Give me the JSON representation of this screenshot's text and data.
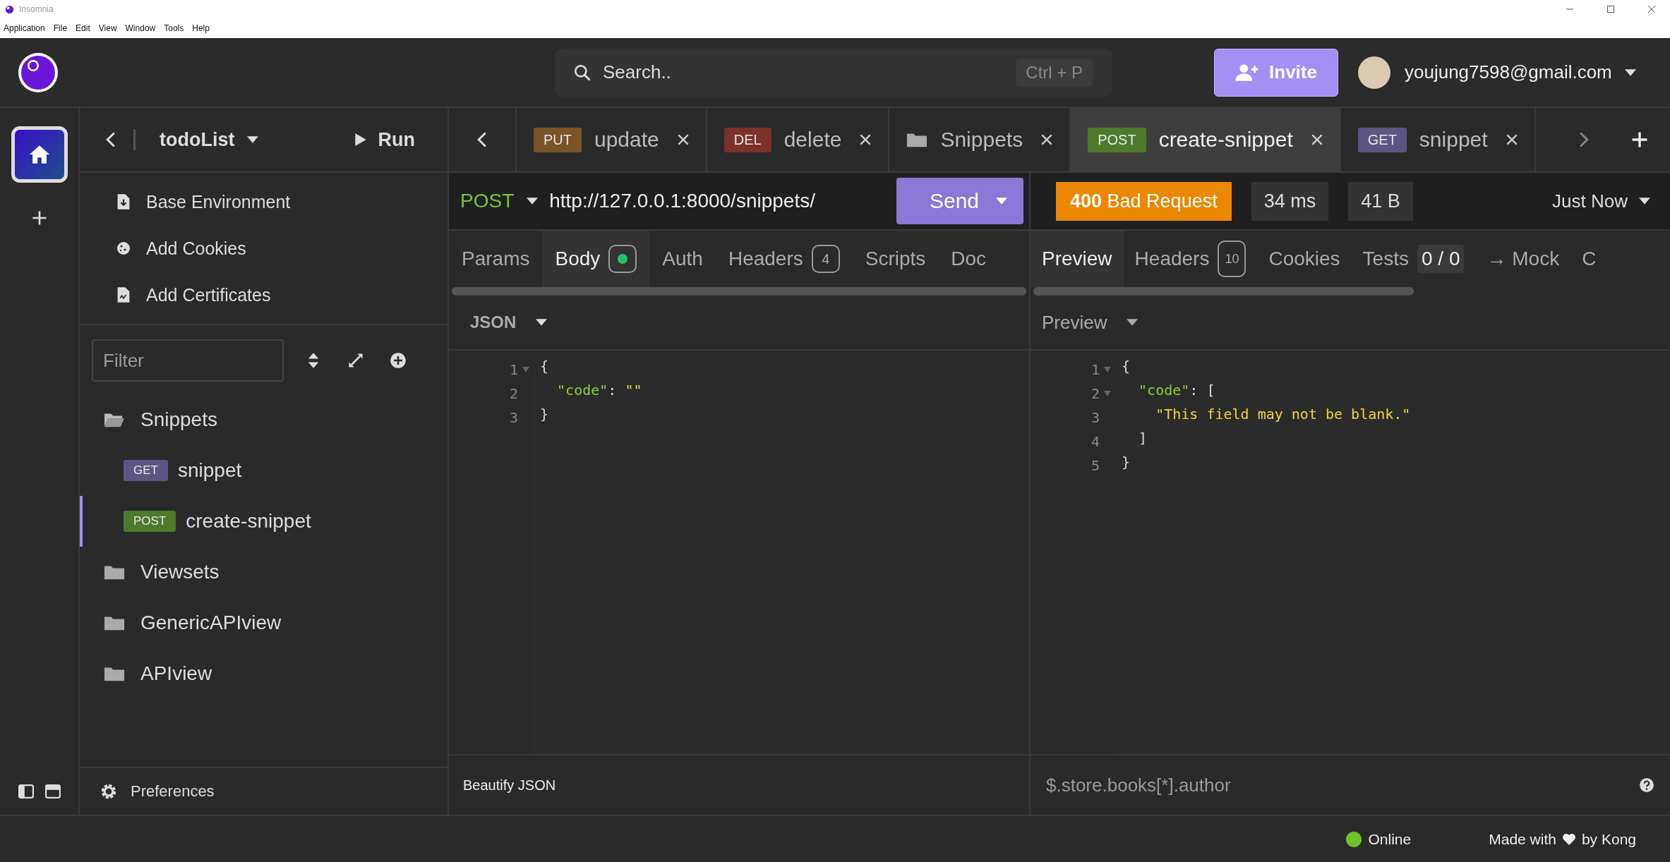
{
  "window": {
    "title": "Insomnia"
  },
  "menu": [
    "Application",
    "File",
    "Edit",
    "View",
    "Window",
    "Tools",
    "Help"
  ],
  "header": {
    "search": {
      "placeholder": "Search..",
      "shortcut": "Ctrl + P"
    },
    "invite": "Invite",
    "user": "youjung7598@gmail.com"
  },
  "sidebar": {
    "project": "todoList",
    "run": "Run",
    "links": [
      {
        "kind": "environment",
        "label": "Base Environment"
      },
      {
        "kind": "cookies",
        "label": "Add Cookies"
      },
      {
        "kind": "certificates",
        "label": "Add Certificates"
      }
    ],
    "filter": {
      "placeholder": "Filter"
    },
    "tree": [
      {
        "kind": "folder",
        "label": "Snippets",
        "expanded": true,
        "children": [
          {
            "kind": "request",
            "method": "GET",
            "color": "#5d5683",
            "label": "snippet",
            "selected": false
          },
          {
            "kind": "request",
            "method": "POST",
            "color": "#4e7a2c",
            "label": "create-snippet",
            "selected": true
          }
        ]
      },
      {
        "kind": "folder",
        "label": "Viewsets",
        "expanded": false
      },
      {
        "kind": "folder",
        "label": "GenericAPIview",
        "expanded": false
      },
      {
        "kind": "folder",
        "label": "APIview",
        "expanded": false
      }
    ],
    "preferences": "Preferences"
  },
  "tabs": [
    {
      "kind": "request",
      "method": "PUT",
      "color": "#7a5424",
      "label": "update",
      "selected": false
    },
    {
      "kind": "request",
      "method": "DEL",
      "color": "#7c3129",
      "label": "delete",
      "selected": false
    },
    {
      "kind": "folder",
      "label": "Snippets",
      "selected": false
    },
    {
      "kind": "request",
      "method": "POST",
      "color": "#4e7a2c",
      "label": "create-snippet",
      "selected": true
    },
    {
      "kind": "request",
      "method": "GET",
      "color": "#5d5683",
      "label": "snippet",
      "selected": false
    }
  ],
  "request": {
    "method": "POST",
    "url": "http://127.0.0.1:8000/snippets/",
    "send": "Send",
    "tabs": [
      {
        "label": "Params",
        "selected": false
      },
      {
        "label": "Body",
        "selected": true,
        "badge": {
          "kind": "dot"
        }
      },
      {
        "label": "Auth",
        "selected": false
      },
      {
        "label": "Headers",
        "selected": false,
        "badge": {
          "kind": "outline",
          "text": "4"
        }
      },
      {
        "label": "Scripts",
        "selected": false
      },
      {
        "label": "Doc",
        "selected": false
      }
    ],
    "body_type": "JSON",
    "lines": [
      {
        "number": "1",
        "fold": true,
        "tokens": [
          {
            "kind": "punct",
            "text": "{"
          }
        ]
      },
      {
        "number": "2",
        "fold": false,
        "tokens": [
          {
            "kind": "key",
            "text": "  \"code\""
          },
          {
            "kind": "punct",
            "text": ": "
          },
          {
            "kind": "string",
            "text": "\"\""
          }
        ]
      },
      {
        "number": "3",
        "fold": false,
        "tokens": [
          {
            "kind": "punct",
            "text": "}"
          }
        ]
      }
    ],
    "footer": "Beautify JSON"
  },
  "response": {
    "status_code": "400",
    "status_text": "Bad Request",
    "time": "34 ms",
    "size": "41 B",
    "when": "Just Now",
    "tabs": [
      {
        "label": "Preview",
        "selected": true
      },
      {
        "label": "Headers",
        "selected": false,
        "badge": {
          "kind": "outline",
          "text": "10"
        }
      },
      {
        "label": "Cookies",
        "selected": false
      },
      {
        "label": "Tests",
        "selected": false,
        "badge": {
          "kind": "filled",
          "text": "0 / 0"
        }
      },
      {
        "label": "→ Mock",
        "selected": false
      },
      {
        "label": "C",
        "selected": false
      }
    ],
    "view": "Preview",
    "lines": [
      {
        "number": "1",
        "fold": true,
        "tokens": [
          {
            "kind": "punct",
            "text": "{"
          }
        ]
      },
      {
        "number": "2",
        "fold": true,
        "tokens": [
          {
            "kind": "key",
            "text": "  \"code\""
          },
          {
            "kind": "punct",
            "text": ": ["
          }
        ]
      },
      {
        "number": "3",
        "fold": false,
        "tokens": [
          {
            "kind": "string",
            "text": "    \"This field may not be blank.\""
          }
        ]
      },
      {
        "number": "4",
        "fold": false,
        "tokens": [
          {
            "kind": "punct",
            "text": "  ]"
          }
        ]
      },
      {
        "number": "5",
        "fold": false,
        "tokens": [
          {
            "kind": "punct",
            "text": "}"
          }
        ]
      }
    ],
    "filter_placeholder": "$.store.books[*].author"
  },
  "status_bar": {
    "online": "Online",
    "credit_before": "Made with",
    "credit_after": "by Kong"
  }
}
